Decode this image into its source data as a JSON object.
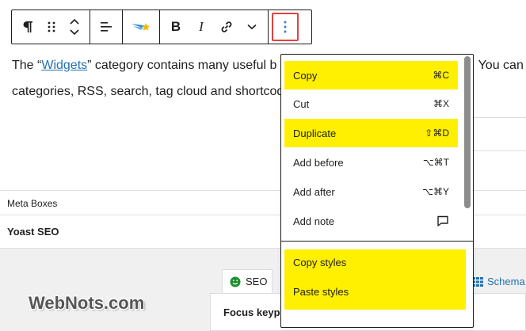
{
  "toolbar": {
    "paragraph_icon": "pilcrow-icon",
    "drag_icon": "drag-handle-icon",
    "move_icon": "chevron-up-down-icon",
    "align_icon": "align-left-icon",
    "highlight_icon": "highlighter-icon",
    "bold_label": "B",
    "italic_label": "I",
    "link_icon": "link-icon",
    "more_rich_icon": "chevron-down-icon",
    "options_icon": "vertical-ellipsis-icon"
  },
  "paragraph": {
    "text_before": "The “",
    "link_text": "Widgets",
    "text_after": "” category contains many useful b",
    "text_right": ". You can",
    "line2": "categories, RSS, search, tag cloud and shortcod"
  },
  "meta": {
    "boxes_label": "Meta Boxes",
    "yoast_label": "Yoast SEO",
    "seo_tab": "SEO",
    "schema_tab": "Schema",
    "focus_label": "Focus keyph"
  },
  "watermark": "WebNots.com",
  "menu": {
    "items": [
      {
        "label": "Copy",
        "shortcut": "⌘C",
        "highlight": true
      },
      {
        "label": "Cut",
        "shortcut": "⌘X",
        "highlight": false
      },
      {
        "label": "Duplicate",
        "shortcut": "⇧⌘D",
        "highlight": true
      },
      {
        "label": "Add before",
        "shortcut": "⌥⌘T",
        "highlight": false
      },
      {
        "label": "Add after",
        "shortcut": "⌥⌘Y",
        "highlight": false
      },
      {
        "label": "Add note",
        "shortcut": "",
        "highlight": false
      }
    ],
    "styles": [
      {
        "label": "Copy styles"
      },
      {
        "label": "Paste styles"
      }
    ]
  },
  "colors": {
    "highlight": "#ffef00",
    "link": "#2271b1",
    "options_button_border": "#e43f3f",
    "yoast_green": "#1e8f2e"
  }
}
